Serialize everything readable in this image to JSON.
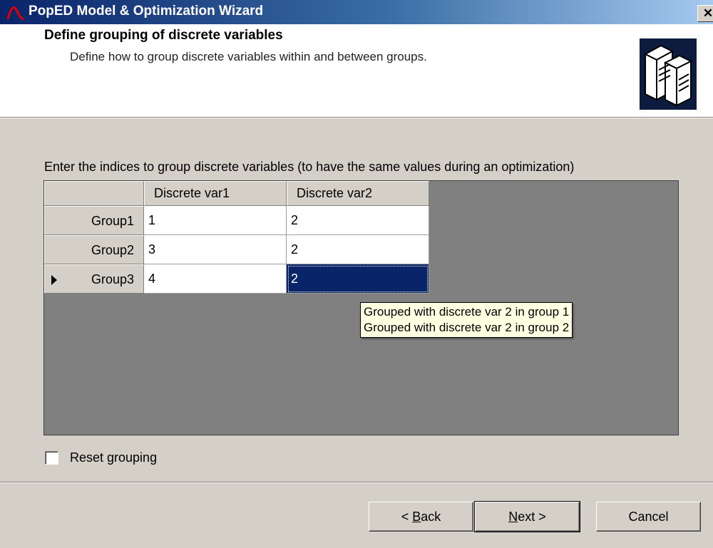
{
  "window": {
    "title": "PopED Model & Optimization Wizard",
    "close_label": "✕"
  },
  "header": {
    "title": "Define grouping of discrete variables",
    "subtitle": "Define how to group discrete variables within and between groups."
  },
  "instructions": "Enter the indices to group discrete variables (to have the same values during an optimization)",
  "grid": {
    "columns": [
      "Discrete var1",
      "Discrete var2"
    ],
    "rows": [
      {
        "label": "Group1",
        "values": [
          "1",
          "2"
        ]
      },
      {
        "label": "Group2",
        "values": [
          "3",
          "2"
        ]
      },
      {
        "label": "Group3",
        "values": [
          "4",
          "2"
        ]
      }
    ],
    "current_row": "Group3",
    "selected_cell": "Group3 / Discrete var2"
  },
  "tooltip": {
    "lines": [
      "Grouped with discrete var 2 in group 1",
      "Grouped with discrete var 2 in group 2"
    ]
  },
  "reset": {
    "label": "Reset grouping",
    "checked": false
  },
  "buttons": {
    "back": {
      "prefix": "< ",
      "mnemonic": "B",
      "rest": "ack"
    },
    "next": {
      "mnemonic": "N",
      "rest": "ext >"
    },
    "cancel": "Cancel"
  },
  "colors": {
    "title_bar": "#0a246a",
    "selection": "#0a246a",
    "grid_background": "#808080",
    "tooltip": "#ffffe1"
  }
}
